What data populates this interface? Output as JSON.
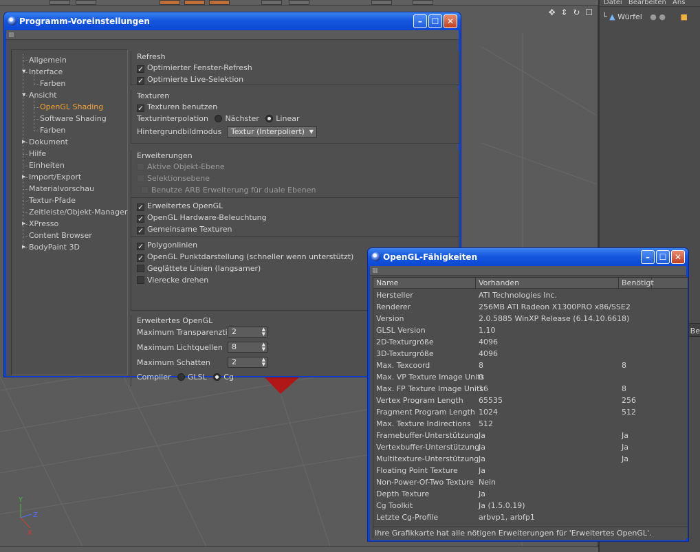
{
  "right_panel": {
    "menu": [
      "Datei",
      "Bearbeiten",
      "Ans"
    ],
    "object_name": "Würfel",
    "side_label": "Be"
  },
  "prefs_window": {
    "title": "Programm-Voreinstellungen",
    "tree": [
      {
        "label": "Allgemein",
        "level": 0,
        "arrow": ""
      },
      {
        "label": "Interface",
        "level": 0,
        "arrow": "down"
      },
      {
        "label": "Farben",
        "level": 1,
        "arrow": ""
      },
      {
        "label": "Ansicht",
        "level": 0,
        "arrow": "down"
      },
      {
        "label": "OpenGL Shading",
        "level": 1,
        "arrow": "",
        "selected": true
      },
      {
        "label": "Software Shading",
        "level": 1,
        "arrow": ""
      },
      {
        "label": "Farben",
        "level": 1,
        "arrow": ""
      },
      {
        "label": "Dokument",
        "level": 0,
        "arrow": "right"
      },
      {
        "label": "Hilfe",
        "level": 0,
        "arrow": ""
      },
      {
        "label": "Einheiten",
        "level": 0,
        "arrow": ""
      },
      {
        "label": "Import/Export",
        "level": 0,
        "arrow": "right"
      },
      {
        "label": "Materialvorschau",
        "level": 0,
        "arrow": ""
      },
      {
        "label": "Textur-Pfade",
        "level": 0,
        "arrow": ""
      },
      {
        "label": "Zeitleiste/Objekt-Manager",
        "level": 0,
        "arrow": ""
      },
      {
        "label": "XPresso",
        "level": 0,
        "arrow": "right"
      },
      {
        "label": "Content Browser",
        "level": 0,
        "arrow": ""
      },
      {
        "label": "BodyPaint 3D",
        "level": 0,
        "arrow": "right"
      }
    ],
    "refresh": {
      "title": "Refresh",
      "opt1": "Optimierter Fenster-Refresh",
      "opt2": "Optimierte Live-Selektion"
    },
    "texturen": {
      "title": "Texturen",
      "use": "Texturen benutzen",
      "interp_label": "Texturinterpolation",
      "interp_a": "Nächster",
      "interp_b": "Linear",
      "bg_label": "Hintergrundbildmodus",
      "bg_value": "Textur (Interpoliert)"
    },
    "erweiterungen": {
      "title": "Erweiterungen",
      "aktive": "Aktive Objekt-Ebene",
      "selektion": "Selektionsebene",
      "arb": "Benutze ARB Erweiterung für duale Ebenen",
      "erw_opengl": "Erweitertes OpenGL",
      "hw_light": "OpenGL Hardware-Beleuchtung",
      "shared_tex": "Gemeinsame Texturen",
      "polylines": "Polygonlinien",
      "points": "OpenGL Punktdarstellung (schneller wenn unterstützt)",
      "smooth": "Geglättete Linien (langsamer)",
      "quads": "Vierecke drehen"
    },
    "erw_opengl": {
      "title": "Erweitertes OpenGL",
      "transp_label": "Maximum Transparenztiefe",
      "transp_value": "2",
      "lights_label": "Maximum Lichtquellen",
      "lights_value": "8",
      "shadows_label": "Maximum Schatten",
      "shadows_value": "2",
      "compiler_label": "Compiler",
      "compiler_a": "GLSL",
      "compiler_b": "Cg"
    }
  },
  "ogl_window": {
    "title": "OpenGL-Fähigkeiten",
    "columns": [
      "Name",
      "Vorhanden",
      "Benötigt"
    ],
    "rows": [
      [
        "Hersteller",
        "ATI Technologies Inc.",
        ""
      ],
      [
        "Renderer",
        "256MB ATI Radeon X1300PRO x86/SSE2",
        ""
      ],
      [
        "Version",
        "2.0.5885 WinXP Release (6.14.10.6618)",
        ""
      ],
      [
        "GLSL Version",
        "1.10",
        ""
      ],
      [
        "2D-Texturgröße",
        "4096",
        ""
      ],
      [
        "3D-Texturgröße",
        "4096",
        ""
      ],
      [
        "Max. Texcoord",
        "8",
        "8"
      ],
      [
        "Max. VP Texture Image Units",
        "0",
        ""
      ],
      [
        "Max. FP Texture Image Units",
        "16",
        "8"
      ],
      [
        "Vertex Program Length",
        "65535",
        "256"
      ],
      [
        "Fragment Program Length",
        "1024",
        "512"
      ],
      [
        "Max. Texture Indirections",
        "512",
        ""
      ],
      [
        "Framebuffer-Unterstützung",
        "Ja",
        "Ja"
      ],
      [
        "Vertexbuffer-Unterstützung",
        "Ja",
        "Ja"
      ],
      [
        "Multitexture-Unterstützung",
        "Ja",
        "Ja"
      ],
      [
        "Floating Point Texture",
        "Ja",
        ""
      ],
      [
        "Non-Power-Of-Two Texture",
        "Nein",
        ""
      ],
      [
        "Depth Texture",
        "Ja",
        ""
      ],
      [
        "Cg Toolkit",
        "Ja (1.5.0.19)",
        ""
      ],
      [
        "Letzte Cg-Profile",
        "arbvp1, arbfp1",
        ""
      ]
    ],
    "footer": "Ihre Grafikkarte hat alle nötigen Erweiterungen für 'Erweitertes OpenGL'."
  }
}
